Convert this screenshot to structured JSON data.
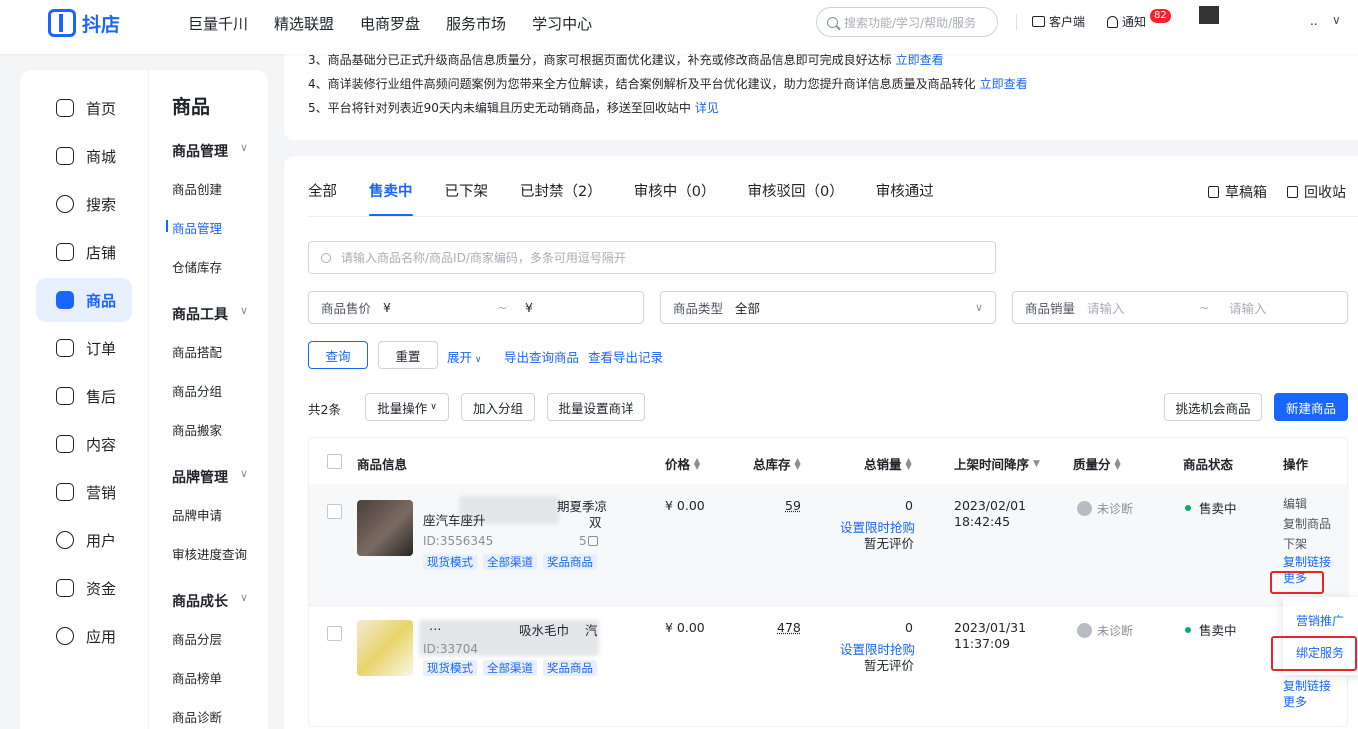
{
  "header": {
    "brand": "抖店",
    "nav": [
      "巨量千川",
      "精选联盟",
      "电商罗盘",
      "服务市场",
      "学习中心"
    ],
    "search_placeholder": "搜索功能/学习/帮助/服务",
    "client_label": "客户端",
    "notify_label": "通知",
    "notify_count": "82",
    "user_tail": "..",
    "user_chevron": "∨"
  },
  "sidebar": {
    "primary": [
      {
        "label": "首页",
        "icon": "home-icon"
      },
      {
        "label": "商城",
        "icon": "mall-icon"
      },
      {
        "label": "搜索",
        "icon": "search-icon"
      },
      {
        "label": "店铺",
        "icon": "store-icon"
      },
      {
        "label": "商品",
        "icon": "product-icon",
        "active": true
      },
      {
        "label": "订单",
        "icon": "order-icon"
      },
      {
        "label": "售后",
        "icon": "aftersale-icon"
      },
      {
        "label": "内容",
        "icon": "content-icon"
      },
      {
        "label": "营销",
        "icon": "marketing-icon"
      },
      {
        "label": "用户",
        "icon": "user-icon"
      },
      {
        "label": "资金",
        "icon": "wallet-icon"
      },
      {
        "label": "应用",
        "icon": "apps-icon"
      }
    ],
    "secondary_title": "商品",
    "groups": [
      {
        "title": "商品管理",
        "items": [
          "商品创建",
          "商品管理",
          "仓储库存"
        ]
      },
      {
        "title": "商品工具",
        "items": [
          "商品搭配",
          "商品分组",
          "商品搬家"
        ]
      },
      {
        "title": "品牌管理",
        "items": [
          "品牌申请",
          "审核进度查询"
        ]
      },
      {
        "title": "商品成长",
        "items": [
          "商品分层",
          "商品榜单",
          "商品诊断"
        ]
      }
    ],
    "active_item": "商品管理"
  },
  "notice": {
    "lines": [
      {
        "text": "3、商品基础分已正式升级商品信息质量分，商家可根据页面优化建议，补充或修改商品信息即可完成良好达标",
        "link": "立即查看"
      },
      {
        "text": "4、商详装修行业组件高频问题案例为您带来全方位解读，结合案例解析及平台优化建议，助力您提升商详信息质量及商品转化",
        "link": "立即查看"
      },
      {
        "text": "5、平台将针对列表近90天内未编辑且历史无动销商品，移送至回收站中",
        "link": "详见"
      }
    ]
  },
  "tabs": [
    {
      "label": "全部"
    },
    {
      "label": "售卖中",
      "active": true
    },
    {
      "label": "已下架"
    },
    {
      "label": "已封禁（2）"
    },
    {
      "label": "审核中（0）"
    },
    {
      "label": "审核驳回（0）"
    },
    {
      "label": "审核通过"
    }
  ],
  "tab_actions": {
    "drafts": "草稿箱",
    "recycle": "回收站"
  },
  "filters": {
    "keyword_placeholder": "请输入商品名称/商品ID/商家编码，多条可用逗号隔开",
    "price_label": "商品售价",
    "price_symbol": "¥",
    "range_sep": "~",
    "type_label": "商品类型",
    "type_value": "全部",
    "sales_label": "商品销量",
    "sales_placeholder": "请输入"
  },
  "filter_actions": {
    "query": "查询",
    "reset": "重置",
    "expand": "展开",
    "export": "导出查询商品",
    "export_log": "查看导出记录"
  },
  "list_toolbar": {
    "total": "共2条",
    "batch": "批量操作",
    "add_group": "加入分组",
    "batch_detail": "批量设置商详",
    "pick": "挑选机会商品",
    "new": "新建商品"
  },
  "table": {
    "columns": [
      "商品信息",
      "价格",
      "总库存",
      "总销量",
      "上架时间降序",
      "质量分",
      "商品状态",
      "操作"
    ],
    "rows": [
      {
        "title_a": "座汽车座升",
        "title_b": "期夏季凉",
        "title_c": "双",
        "id": "ID:3556345",
        "id_tail": "5",
        "tags": [
          "现货模式",
          "全部渠道",
          "奖品商品"
        ],
        "price": "¥ 0.00",
        "stock": "59",
        "sales": "0",
        "flash": "设置限时抢购",
        "rating": "暂无评价",
        "date": "2023/02/01",
        "time": "18:42:45",
        "quality": "未诊断",
        "status": "售卖中",
        "ops": [
          "编辑",
          "复制商品",
          "下架",
          "复制链接",
          "更多"
        ]
      },
      {
        "title_a": "…",
        "title_b": "吸水毛巾",
        "title_c": "汽",
        "id": "ID:33704",
        "id_tail": "",
        "tags": [
          "现货模式",
          "全部渠道",
          "奖品商品"
        ],
        "price": "¥ 0.00",
        "stock": "478",
        "sales": "0",
        "flash": "设置限时抢购",
        "rating": "暂无评价",
        "date": "2023/01/31",
        "time": "11:37:09",
        "quality": "未诊断",
        "status": "售卖中",
        "ops": [
          "复制链接",
          "更多"
        ]
      }
    ]
  },
  "more_menu": [
    "营销推广",
    "绑定服务"
  ],
  "colors": {
    "accent": "#1966ff",
    "badge": "#f5222d",
    "highlight": "#e5272d",
    "status_ok": "#00b365"
  }
}
